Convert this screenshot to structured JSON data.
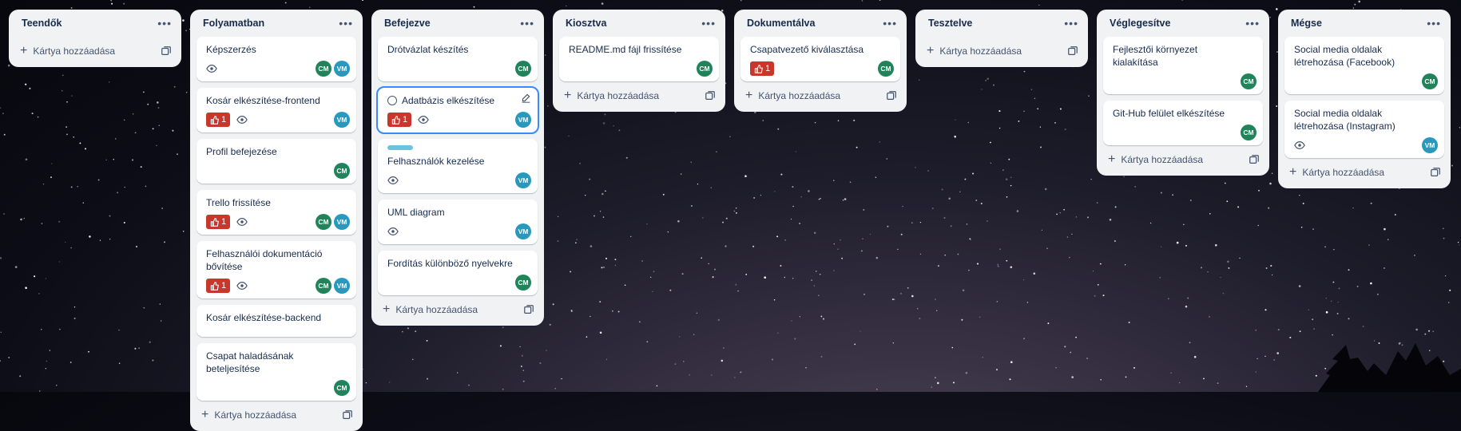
{
  "theme": {
    "list_bg": "#f1f2f4",
    "vote_color": "#c9372c",
    "avatar_cm": "#1f845a",
    "avatar_vm": "#2898bd",
    "active_outline": "#388bff",
    "cover_color": "#6cc3e0"
  },
  "icons": {
    "menu": "ellipsis-icon",
    "add": "plus-icon",
    "template": "card-template-icon",
    "watch": "eye-icon",
    "vote": "thumbs-up-icon",
    "edit": "pencil-icon",
    "complete": "circle-checkbox-icon"
  },
  "lists": [
    {
      "title": "Teendők",
      "add_label": "Kártya hozzáadása",
      "cards": []
    },
    {
      "title": "Folyamatban",
      "add_label": "Kártya hozzáadása",
      "cards": [
        {
          "title": "Képszerzés",
          "votes": null,
          "watch": true,
          "members": [
            "CM",
            "VM"
          ]
        },
        {
          "title": "Kosár elkészítése-frontend",
          "votes": "1",
          "watch": true,
          "members": [
            "VM"
          ]
        },
        {
          "title": "Profil befejezése",
          "votes": null,
          "watch": false,
          "members": [
            "CM"
          ]
        },
        {
          "title": "Trello frissítése",
          "votes": "1",
          "watch": true,
          "members": [
            "CM",
            "VM"
          ]
        },
        {
          "title": "Felhasználói dokumentáció bővítése",
          "votes": "1",
          "watch": true,
          "members": [
            "CM",
            "VM"
          ]
        },
        {
          "title": "Kosár elkészítése-backend",
          "votes": null,
          "watch": false,
          "members": []
        },
        {
          "title": "Csapat haladásának beteljesítése",
          "votes": null,
          "watch": false,
          "members": [
            "CM"
          ]
        }
      ]
    },
    {
      "title": "Befejezve",
      "add_label": "Kártya hozzáadása",
      "cards": [
        {
          "title": "Drótvázlat készítés",
          "votes": null,
          "watch": false,
          "members": [
            "CM"
          ]
        },
        {
          "title": "Adatbázis elkészítése",
          "votes": "1",
          "watch": true,
          "members": [
            "VM"
          ],
          "active": true
        },
        {
          "title": "Felhasználók kezelése",
          "votes": null,
          "watch": true,
          "members": [
            "VM"
          ],
          "cover": true
        },
        {
          "title": "UML diagram",
          "votes": null,
          "watch": true,
          "members": [
            "VM"
          ]
        },
        {
          "title": "Fordítás különböző nyelvekre",
          "votes": null,
          "watch": false,
          "members": [
            "CM"
          ]
        }
      ]
    },
    {
      "title": "Kiosztva",
      "add_label": "Kártya hozzáadása",
      "cards": [
        {
          "title": "README.md fájl frissítése",
          "votes": null,
          "watch": false,
          "members": [
            "CM"
          ]
        }
      ]
    },
    {
      "title": "Dokumentálva",
      "add_label": "Kártya hozzáadása",
      "cards": [
        {
          "title": "Csapatvezető kiválasztása",
          "votes": "1",
          "watch": false,
          "members": [
            "CM"
          ]
        }
      ]
    },
    {
      "title": "Tesztelve",
      "add_label": "Kártya hozzáadása",
      "cards": []
    },
    {
      "title": "Véglegesítve",
      "add_label": "Kártya hozzáadása",
      "cards": [
        {
          "title": "Fejlesztői környezet kialakítása",
          "votes": null,
          "watch": false,
          "members": [
            "CM"
          ]
        },
        {
          "title": "Git-Hub felület elkészítése",
          "votes": null,
          "watch": false,
          "members": [
            "CM"
          ]
        }
      ]
    },
    {
      "title": "Mégse",
      "add_label": "Kártya hozzáadása",
      "cards": [
        {
          "title": "Social media oldalak létrehozása (Facebook)",
          "votes": null,
          "watch": false,
          "members": [
            "CM"
          ]
        },
        {
          "title": "Social media oldalak létrehozása (Instagram)",
          "votes": null,
          "watch": true,
          "members": [
            "VM"
          ]
        }
      ]
    }
  ]
}
